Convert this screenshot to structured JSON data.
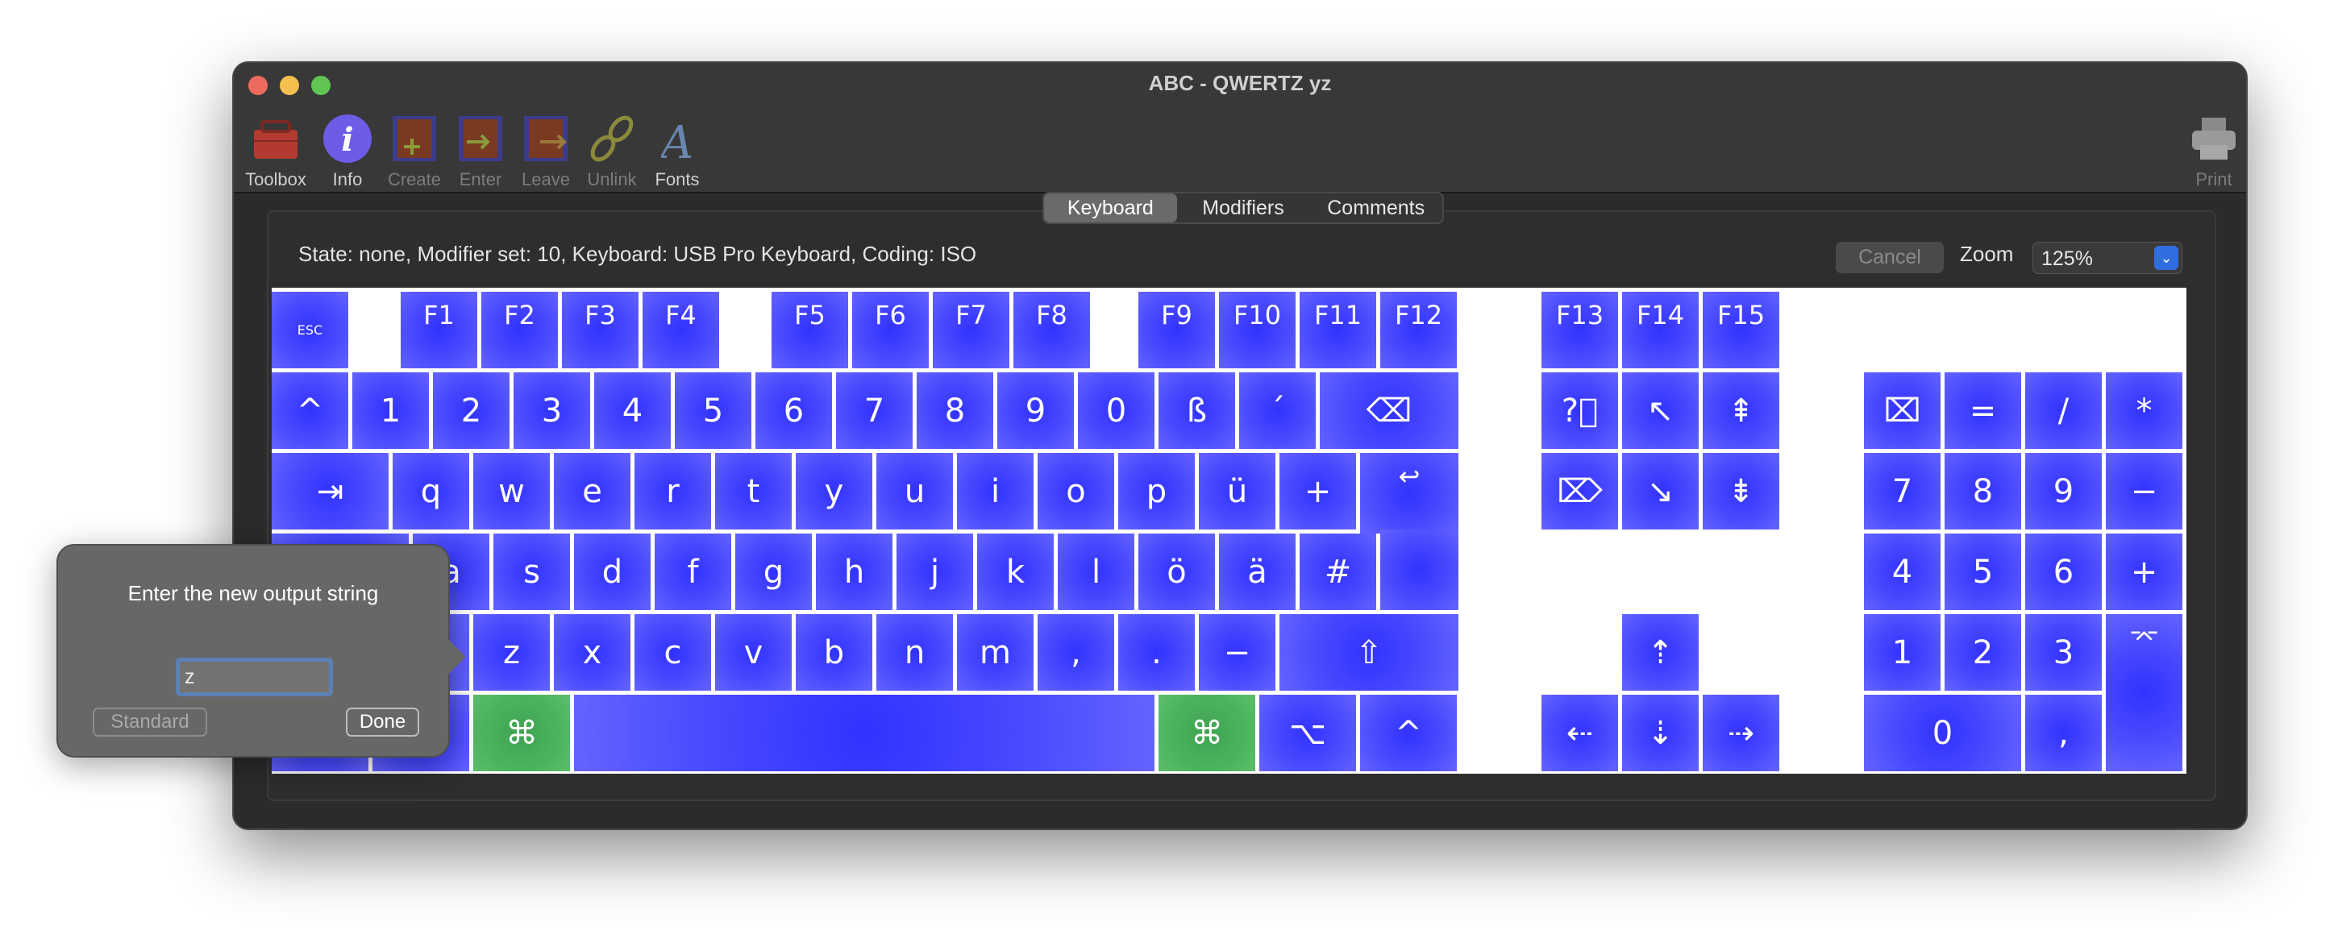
{
  "window": {
    "title": "ABC - QWERTZ yz",
    "traffic_lights": {
      "close": "#ec6a5e",
      "minimize": "#f4bf4f",
      "zoom": "#61c554"
    }
  },
  "toolbar": {
    "items": [
      {
        "label": "Toolbox",
        "icon": "toolbox-icon",
        "enabled": true
      },
      {
        "label": "Info",
        "icon": "info-icon",
        "enabled": true
      },
      {
        "label": "Create",
        "icon": "create-dead-key-icon",
        "enabled": false
      },
      {
        "label": "Enter",
        "icon": "enter-dead-key-icon",
        "enabled": false
      },
      {
        "label": "Leave",
        "icon": "leave-dead-key-icon",
        "enabled": false
      },
      {
        "label": "Unlink",
        "icon": "unlink-icon",
        "enabled": false
      },
      {
        "label": "Fonts",
        "icon": "fonts-icon",
        "enabled": true
      }
    ],
    "print": {
      "label": "Print",
      "icon": "printer-icon",
      "enabled": false
    }
  },
  "tabs": [
    {
      "label": "Keyboard",
      "selected": true
    },
    {
      "label": "Modifiers",
      "selected": false
    },
    {
      "label": "Comments",
      "selected": false
    }
  ],
  "status": "State: none, Modifier set: 10, Keyboard: USB Pro Keyboard, Coding: ISO",
  "cancel_label": "Cancel",
  "zoom": {
    "label": "Zoom",
    "value": "125%"
  },
  "colors": {
    "key": "#3a3aff",
    "key_selected_modifier": "#4cb35d"
  },
  "keys": [
    {
      "label": "ESC"
    },
    {
      "label": "F1"
    },
    {
      "label": "F2"
    },
    {
      "label": "F3"
    },
    {
      "label": "F4"
    },
    {
      "label": "F5"
    },
    {
      "label": "F6"
    },
    {
      "label": "F7"
    },
    {
      "label": "F8"
    },
    {
      "label": "F9"
    },
    {
      "label": "F10"
    },
    {
      "label": "F11"
    },
    {
      "label": "F12"
    },
    {
      "label": "F13"
    },
    {
      "label": "F14"
    },
    {
      "label": "F15"
    },
    {
      "label": "^"
    },
    {
      "label": "1"
    },
    {
      "label": "2"
    },
    {
      "label": "3"
    },
    {
      "label": "4"
    },
    {
      "label": "5"
    },
    {
      "label": "6"
    },
    {
      "label": "7"
    },
    {
      "label": "8"
    },
    {
      "label": "9"
    },
    {
      "label": "0"
    },
    {
      "label": "ß"
    },
    {
      "label": "´"
    },
    {
      "label": "⌫"
    },
    {
      "label": "?⃝"
    },
    {
      "label": "↖"
    },
    {
      "label": "⇞"
    },
    {
      "label": "⌧"
    },
    {
      "label": "="
    },
    {
      "label": "/"
    },
    {
      "label": "*"
    },
    {
      "label": "⇥"
    },
    {
      "label": "q"
    },
    {
      "label": "w"
    },
    {
      "label": "e"
    },
    {
      "label": "r"
    },
    {
      "label": "t"
    },
    {
      "label": "y"
    },
    {
      "label": "u"
    },
    {
      "label": "i"
    },
    {
      "label": "o"
    },
    {
      "label": "p"
    },
    {
      "label": "ü"
    },
    {
      "label": "+"
    },
    {
      "label": "↩"
    },
    {
      "label": ""
    },
    {
      "label": "⌦"
    },
    {
      "label": "↘"
    },
    {
      "label": "⇟"
    },
    {
      "label": "7"
    },
    {
      "label": "8"
    },
    {
      "label": "9"
    },
    {
      "label": "−"
    },
    {
      "label": ""
    },
    {
      "label": "a"
    },
    {
      "label": "s"
    },
    {
      "label": "d"
    },
    {
      "label": "f"
    },
    {
      "label": "g"
    },
    {
      "label": "h"
    },
    {
      "label": "j"
    },
    {
      "label": "k"
    },
    {
      "label": "l"
    },
    {
      "label": "ö"
    },
    {
      "label": "ä"
    },
    {
      "label": "#"
    },
    {
      "label": "4"
    },
    {
      "label": "5"
    },
    {
      "label": "6"
    },
    {
      "label": "+"
    },
    {
      "label": ""
    },
    {
      "label": "z"
    },
    {
      "label": "x"
    },
    {
      "label": "c"
    },
    {
      "label": "v"
    },
    {
      "label": "b"
    },
    {
      "label": "n"
    },
    {
      "label": "m"
    },
    {
      "label": ","
    },
    {
      "label": "."
    },
    {
      "label": "−"
    },
    {
      "label": "⇧"
    },
    {
      "label": "⇡"
    },
    {
      "label": "1"
    },
    {
      "label": "2"
    },
    {
      "label": "3"
    },
    {
      "label": "⌤"
    },
    {
      "label": ""
    },
    {
      "label": ""
    },
    {
      "label": "⌘",
      "color": "green"
    },
    {
      "label": ""
    },
    {
      "label": "⌘",
      "color": "green"
    },
    {
      "label": "⌥"
    },
    {
      "label": "^"
    },
    {
      "label": "⇠"
    },
    {
      "label": "⇣"
    },
    {
      "label": "⇢"
    },
    {
      "label": "0"
    },
    {
      "label": ","
    }
  ],
  "popover": {
    "title": "Enter the new output string",
    "input_value": "z",
    "standard_label": "Standard",
    "done_label": "Done"
  }
}
